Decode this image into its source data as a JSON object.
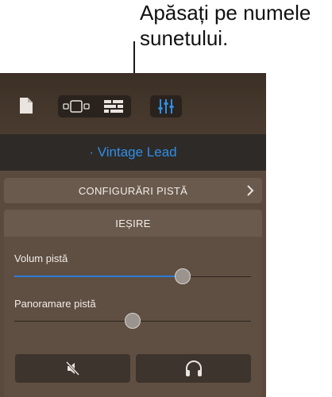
{
  "callout": {
    "line1": "Apăsați pe numele",
    "line2": "sunetului."
  },
  "toolbar": {
    "icons": [
      "document-icon",
      "smart-controls-icon",
      "tracks-view-icon",
      "mixer-icon"
    ]
  },
  "track": {
    "name": "Vintage Lead",
    "color": "#2e8fe8"
  },
  "settings": {
    "label": "CONFIGURĂRI PISTĂ"
  },
  "output": {
    "header": "IEȘIRE",
    "volume": {
      "label": "Volum pistă",
      "value": 0.71
    },
    "pan": {
      "label": "Panoramare pistă",
      "value": 0.5
    }
  },
  "buttons": {
    "mute_icon": "mute-speaker-icon",
    "solo_icon": "headphones-icon"
  }
}
